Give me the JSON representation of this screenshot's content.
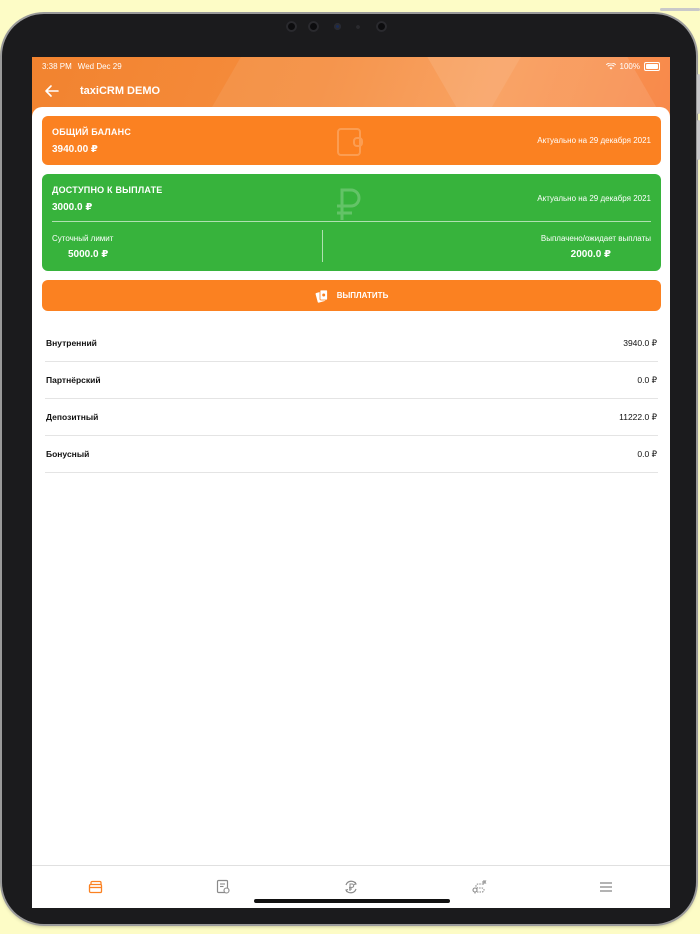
{
  "status_bar": {
    "time": "3:38 PM",
    "date": "Wed Dec 29",
    "battery": "100%"
  },
  "header": {
    "title": "taxiCRM DEMO"
  },
  "balance_card": {
    "label": "ОБЩИЙ БАЛАНС",
    "amount": "3940.00 ₽",
    "date": "Актуально на 29 декабря 2021",
    "icon": "wallet-icon",
    "color": "#fb8121"
  },
  "available_card": {
    "label": "ДОСТУПНО К ВЫПЛАТЕ",
    "amount": "3000.0 ₽",
    "date": "Актуально на 29 декабря 2021",
    "icon": "ruble-icon",
    "color": "#37b33c",
    "daily_limit_label": "Суточный лимит",
    "daily_limit_value": "5000.0 ₽",
    "paid_label": "Выплачено/ожидает выплаты",
    "paid_value": "2000.0 ₽"
  },
  "payout_button": {
    "label": "ВЫПЛАТИТЬ",
    "icon": "cash-card-icon"
  },
  "accounts": [
    {
      "name": "Внутренний",
      "value": "3940.0 ₽"
    },
    {
      "name": "Партнёрский",
      "value": "0.0 ₽"
    },
    {
      "name": "Депозитный",
      "value": "11222.0 ₽"
    },
    {
      "name": "Бонусный",
      "value": "0.0 ₽"
    }
  ],
  "tabbar": {
    "active_color": "#fb8121",
    "inactive_color": "#8a8a8a",
    "tabs": [
      {
        "icon": "wallet-cards-icon",
        "active": true
      },
      {
        "icon": "document-settings-icon",
        "active": false
      },
      {
        "icon": "ruble-cycle-icon",
        "active": false
      },
      {
        "icon": "route-icon",
        "active": false
      },
      {
        "icon": "menu-icon",
        "active": false
      }
    ]
  }
}
